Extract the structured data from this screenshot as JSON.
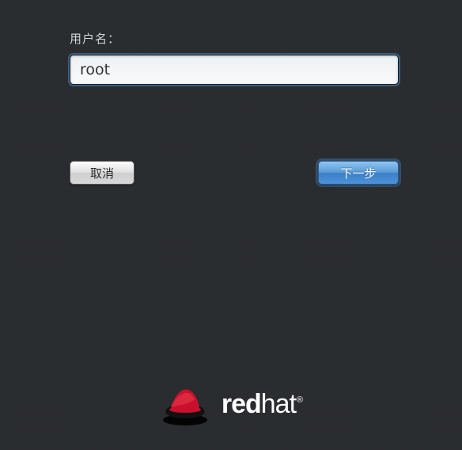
{
  "login": {
    "username_label": "用户名：",
    "username_value": "root",
    "cancel_label": "取消",
    "next_label": "下一步"
  },
  "branding": {
    "name_bold": "red",
    "name_light": "hat",
    "trademark": "®"
  }
}
